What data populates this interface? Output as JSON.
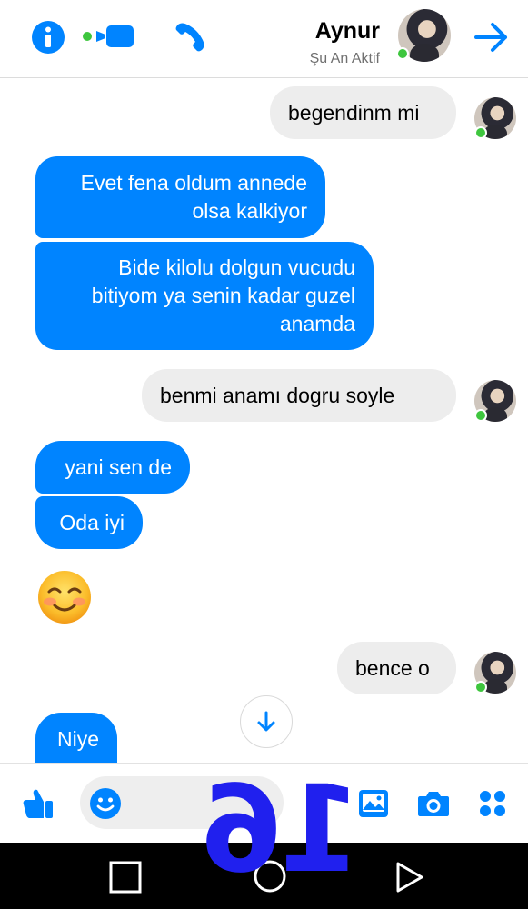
{
  "header": {
    "contact_name": "Aynur",
    "contact_status": "Şu An Aktif",
    "icons": [
      "info-icon",
      "video-call-icon",
      "phone-icon",
      "back-arrow-icon"
    ]
  },
  "messages": [
    {
      "direction": "incoming",
      "text": "begendinm mi"
    },
    {
      "direction": "outgoing",
      "text": "Evet fena oldum annede olsa kalkiyor",
      "lines": [
        "Evet fena oldum annede",
        "olsa kalkiyor"
      ]
    },
    {
      "direction": "outgoing",
      "text": "Bide kilolu dolgun vucudu bitiyom ya senin kadar guzel anamda",
      "lines": [
        "Bide kilolu dolgun vucudu",
        "bitiyom ya senin kadar guzel",
        "anamda"
      ]
    },
    {
      "direction": "incoming",
      "text": "benmi anamı dogru soyle"
    },
    {
      "direction": "outgoing",
      "text": "yani sen de"
    },
    {
      "direction": "outgoing",
      "text": "Oda iyi"
    },
    {
      "direction": "outgoing",
      "text": "☺️",
      "type": "emoji"
    },
    {
      "direction": "incoming",
      "text": "bence o"
    },
    {
      "direction": "outgoing",
      "text": "Niye"
    }
  ],
  "composer": {
    "icons": [
      "like-icon",
      "smile-icon",
      "gallery-icon",
      "camera-icon",
      "more-icon"
    ]
  },
  "overlay": {
    "number": "16"
  },
  "colors": {
    "accent": "#0084ff",
    "incoming_bubble": "#ededed",
    "online": "#3ec63e",
    "overlay": "#2020ee"
  }
}
